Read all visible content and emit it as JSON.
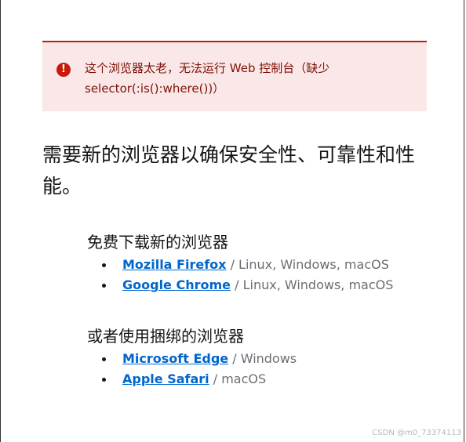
{
  "alert": {
    "icon": "exclamation-circle-icon",
    "message": "这个浏览器太老，无法运行 Web 控制台（缺少 selector(:is():where())）"
  },
  "heading": "需要新的浏览器以确保安全性、可靠性和性能。",
  "sections": [
    {
      "title": "免费下载新的浏览器",
      "items": [
        {
          "name": "Mozilla Firefox",
          "platforms": "Linux, Windows, macOS"
        },
        {
          "name": "Google Chrome",
          "platforms": "Linux, Windows, macOS"
        }
      ]
    },
    {
      "title": "或者使用捆绑的浏览器",
      "items": [
        {
          "name": "Microsoft Edge",
          "platforms": "Windows"
        },
        {
          "name": "Apple Safari",
          "platforms": "macOS"
        }
      ]
    }
  ],
  "separator": " / ",
  "watermark": "CSDN @m0_73374113",
  "colors": {
    "danger": "#c9190b",
    "alert_bg": "#fae7e7",
    "link": "#0066cc"
  }
}
